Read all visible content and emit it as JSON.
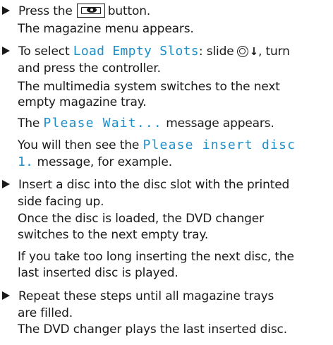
{
  "steps": [
    {
      "lines": [
        {
          "pre": "Press the",
          "post": "button."
        },
        {
          "text": "The magazine menu appears."
        }
      ]
    },
    {
      "lines": [
        {
          "pre": "To select ",
          "display": "Load Empty Slots",
          "post": ": slide",
          "post2": ", turn"
        },
        {
          "text": "and press the controller."
        },
        {
          "text": "The multimedia system switches to the next"
        },
        {
          "text": "empty magazine tray."
        },
        {
          "pre": "The ",
          "display": "Please Wait...",
          "post": " message appears."
        },
        {
          "pre": "You will then see the ",
          "display": "Please insert disc"
        },
        {
          "display": "1.",
          "post": " message, for example."
        }
      ]
    },
    {
      "lines": [
        {
          "text": "Insert a disc into the disc slot with the printed"
        },
        {
          "text": "side facing up."
        },
        {
          "text": "Once the disc is loaded, the DVD changer"
        },
        {
          "text": "switches to the next empty tray."
        },
        {
          "text": "If you take too long inserting the next disc, the"
        },
        {
          "text": "last inserted disc is played."
        }
      ]
    },
    {
      "lines": [
        {
          "text": "Repeat these steps until all magazine trays"
        },
        {
          "text": "are filled."
        },
        {
          "text": "The DVD changer plays the last inserted disc."
        }
      ]
    }
  ],
  "icons": {
    "button": "eject-disc-button-icon",
    "controller": "controller-slide-down-icon",
    "bullet": "triangle-bullet-icon"
  },
  "colors": {
    "text": "#1a1a1a",
    "display_text": "#1f8fc9"
  }
}
